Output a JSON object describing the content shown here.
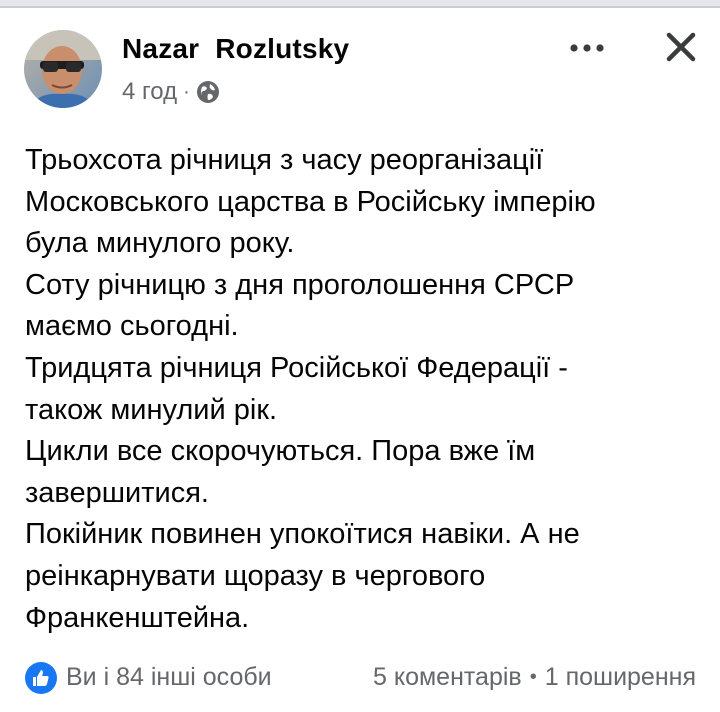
{
  "post": {
    "author": "Nazar  Rozlutsky",
    "time": "4 год",
    "meta_separator": "·",
    "privacy_icon": "globe-icon",
    "more_icon": "more-horizontal-icon",
    "close_icon": "close-icon",
    "text_lines": [
      "Трьохсота річниця з часу реорганізації",
      "Московського царства в Російську імперію",
      "була минулого року.",
      "Соту річницю з дня проголошення СРСР",
      "маємо сьогодні.",
      "Тридцята річниця Російської Федерації -",
      "також минулий рік.",
      "Цикли все скорочуються. Пора вже їм",
      "завершитися.",
      "Покійник повинен упокоїтися навіки. А не",
      "реінкарнувати щоразу в чергового",
      "Франкенштейна."
    ]
  },
  "footer": {
    "like_icon": "thumbs-up-icon",
    "reactions": "Ви і 84 інші особи",
    "comments": "5 коментарів",
    "separator": "•",
    "shares": "1 поширення"
  },
  "colors": {
    "accent": "#1877f2",
    "secondary_text": "#65676b",
    "primary_text": "#050505"
  }
}
